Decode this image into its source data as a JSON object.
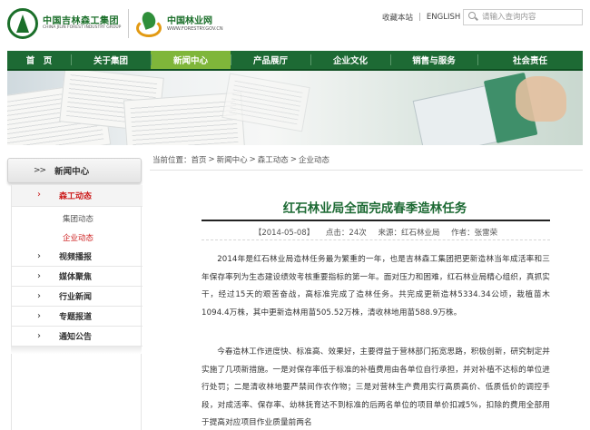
{
  "header": {
    "logo1": {
      "cn": "中国吉林森工集团",
      "en": "CHINA JILIN FOREST INDUSTRY GROUP"
    },
    "logo2": {
      "cn": "中国林业网",
      "en": "WWW.FORESTRY.GOV.CN"
    },
    "top_links": [
      "收藏本站",
      "ENGLISH"
    ],
    "search": {
      "placeholder": "请输入查询内容",
      "icon": "search-icon"
    }
  },
  "nav": {
    "items": [
      "首　页",
      "关于集团",
      "新闻中心",
      "产品展厅",
      "企业文化",
      "销售与服务",
      "社会责任"
    ],
    "active_index": 2,
    "colors": {
      "bar": "#1d6a34",
      "active": "#7fb63a"
    }
  },
  "breadcrumb": {
    "prefix": "当前位置：",
    "items": [
      "首页",
      "新闻中心",
      "森工动态",
      "企业动态"
    ],
    "separator": ">"
  },
  "sidebar": {
    "head_chevron": ">>",
    "title": "新闻中心",
    "active_item": "森工动态",
    "subitems": [
      "集团动态",
      "企业动态"
    ],
    "current_subitem": "企业动态",
    "items": [
      "视频播报",
      "媒体聚焦",
      "行业新闻",
      "专题报道",
      "通知公告"
    ]
  },
  "article": {
    "title": "红石林业局全面完成春季造林任务",
    "meta": {
      "date": "【2014-05-08】",
      "hits": "点击：24次",
      "source": "来源：红石林业局",
      "author": "作者：张雷荣"
    },
    "paragraphs": [
      "2014年是红石林业局造林任务最为繁重的一年，也是吉林森工集团把更新造林当年成活率和三年保存率列为生态建设绩效考核重要指标的第一年。面对压力和困难，红石林业局精心组织，真抓实干，经过15天的艰苦奋战，高标准完成了造林任务。共完成更新造林5334.34公顷，栽植苗木1094.4万株，其中更新造林用苗505.52万株，清收林地用苗588.9万株。",
      "今春造林工作进度快、标准高、效果好，主要得益于营林部门拓宽思路，积极创新，研究制定并实施了几项新措施。一是对保存率低于标准的补植费用由各单位自行承担，并对补植不达标的单位进行处罚；二是清收林地要严禁间作农作物；三是对营林生产费用实行高质高价、低质低价的调控手段，对成活率、保存率、幼林抚育达不到标准的后两名单位的项目单价扣减5%，扣除的费用全部用于提高对应项目作业质量前两名"
    ],
    "accent_color": "#1d6a34"
  }
}
